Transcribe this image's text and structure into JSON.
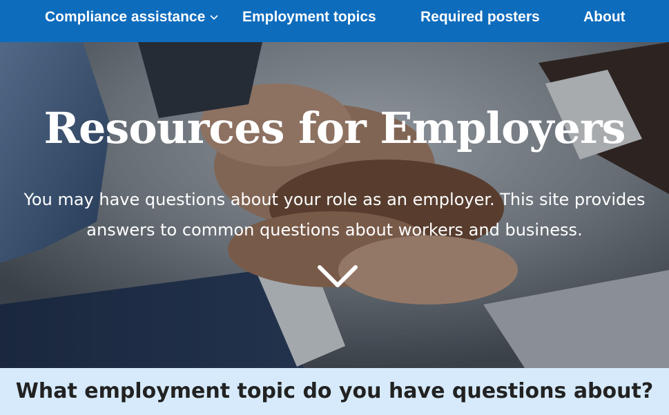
{
  "nav": {
    "compliance": "Compliance assistance",
    "topics": "Employment topics",
    "posters": "Required posters",
    "about": "About"
  },
  "hero": {
    "title": "Resources for Employers",
    "subtitle_line1": "You may have questions about your role as an employer. This site provides",
    "subtitle_line2": "answers to common questions about workers and business."
  },
  "question": {
    "text": "What employment topic do you have questions about?"
  },
  "colors": {
    "nav_bg": "#0e6cbd",
    "band_bg": "#d6eafb"
  },
  "icons": {
    "nav_dropdown": "chevron-down-icon",
    "scroll_down": "chevron-down-icon"
  }
}
